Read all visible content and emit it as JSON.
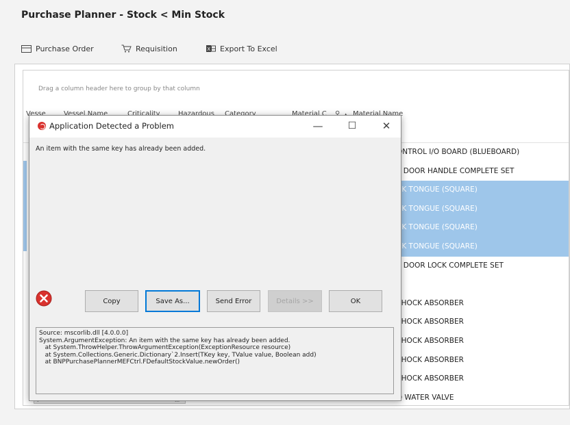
{
  "app": {
    "title": "Purchase Planner - Stock < Min Stock"
  },
  "toolbar": {
    "purchase_order": {
      "label": "Purchase Order",
      "icon": "purchase-order-icon"
    },
    "requisition": {
      "label": "Requisition",
      "icon": "cart-icon"
    },
    "export_excel": {
      "label": "Export To Excel",
      "icon": "excel-icon"
    }
  },
  "grid": {
    "group_hint": "Drag a column header here to group by that column",
    "columns": [
      "Vesse",
      "Vessel Name",
      "Criticality",
      "Hazardous",
      "Category",
      "Material C",
      "Material Name"
    ],
    "rows": [
      {
        "material_name": "ONTROL I/O BOARD (BLUEBOARD)",
        "selected": false
      },
      {
        "material_name": "Y DOOR HANDLE COMPLETE SET",
        "selected": false
      },
      {
        "material_name": "CK TONGUE (SQUARE)",
        "selected": true
      },
      {
        "material_name": "CK TONGUE (SQUARE)",
        "selected": true
      },
      {
        "material_name": "CK TONGUE (SQUARE)",
        "selected": true
      },
      {
        "material_name": "CK TONGUE (SQUARE)",
        "selected": true
      },
      {
        "material_name": "Y DOOR LOCK COMPLETE SET",
        "selected": false
      },
      {
        "material_name": "",
        "selected": false
      },
      {
        "material_name": "SHOCK ABSORBER",
        "selected": false
      },
      {
        "material_name": "SHOCK ABSORBER",
        "selected": false
      },
      {
        "material_name": "SHOCK ABSORBER",
        "selected": false
      },
      {
        "material_name": "SHOCK ABSORBER",
        "selected": false
      },
      {
        "material_name": "SHOCK ABSORBER",
        "selected": false
      },
      {
        "material_name": "D WATER VALVE",
        "selected": false
      }
    ],
    "scroll_grip": "III"
  },
  "dialog": {
    "title": "Application Detected a Problem",
    "message": "An item with the same key has already been added.",
    "buttons": {
      "copy": "Copy",
      "save_as": "Save As...",
      "send_error": "Send Error",
      "details": "Details >>",
      "ok": "OK"
    },
    "details_text": "Source: mscorlib.dll [4.0.0.0]\nSystem.ArgumentException: An item with the same key has already been added.\n   at System.ThrowHelper.ThrowArgumentException(ExceptionResource resource)\n   at System.Collections.Generic.Dictionary`2.Insert(TKey key, TValue value, Boolean add)\n   at BNPPurchasePlannerMEFCtrl.FDefaultStockValue.newOrder()"
  },
  "colors": {
    "selected_row": "#9ec6ea",
    "error_red": "#d9322e",
    "focus_blue": "#0078d7"
  }
}
